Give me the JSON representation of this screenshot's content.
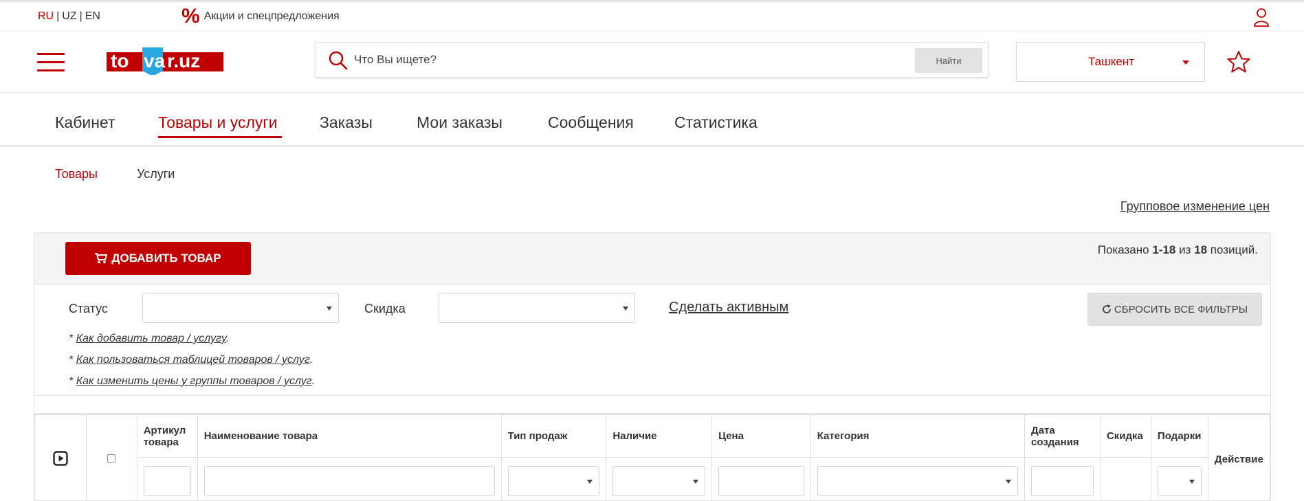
{
  "topbar": {
    "langs": [
      "RU",
      "UZ",
      "EN"
    ],
    "lang_sep": "|",
    "promo_icon": "%",
    "promo_label": "Акции и спецпредложения",
    "user_icon": "user-icon"
  },
  "header": {
    "logo_text": "tovar.uz",
    "search_placeholder": "Что Вы ищете?",
    "search_button": "Найти",
    "city": "Ташкент",
    "fav_icon": "star-icon"
  },
  "main_nav": [
    "Кабинет",
    "Товары и услуги",
    "Заказы",
    "Мои заказы",
    "Сообщения",
    "Статистика"
  ],
  "sub_nav": [
    "Товары",
    "Услуги"
  ],
  "group_price_link": "Групповое изменение цен",
  "panel": {
    "add_button": "ДОБАВИТЬ ТОВАР",
    "summary": {
      "prefix": "Показано",
      "range": "1-18",
      "mid": "из",
      "total": "18",
      "suffix": "позиций."
    },
    "filters": {
      "status_label": "Статус",
      "discount_label": "Скидка",
      "make_active": "Сделать активным",
      "reset_button": "СБРОСИТЬ ВСЕ ФИЛЬТРЫ"
    },
    "help_links": [
      "Как добавить товар / услугу",
      "Как пользоваться таблицей товаров / услуг",
      "Как изменить цены у группы товаров / услуг"
    ],
    "help_prefix": "*",
    "help_suffix": "."
  },
  "table": {
    "headers": {
      "sku": "Артикул товара",
      "name": "Наименование товара",
      "sale_type": "Тип продаж",
      "stock": "Наличие",
      "price": "Цена",
      "category": "Категория",
      "date": "Дата создания",
      "discount": "Скидка",
      "gifts": "Подарки",
      "action": "Действие"
    }
  },
  "colors": {
    "brand_red": "#c00000",
    "panel_bg": "#f4f4f4",
    "button_gray": "#e2e2e2"
  }
}
